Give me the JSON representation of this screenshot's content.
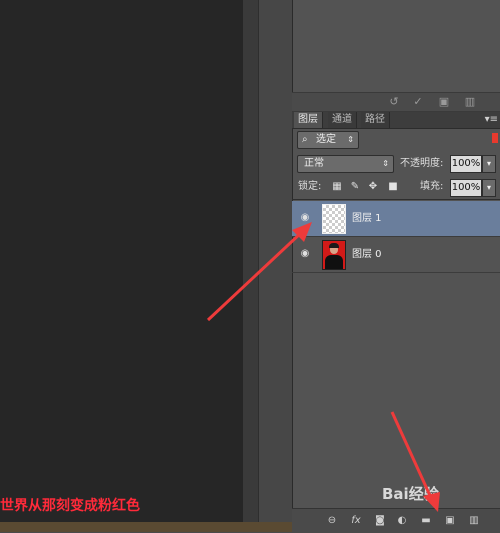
{
  "history_panel": {
    "icons": [
      "undo-icon",
      "check-icon",
      "new-snapshot-icon",
      "trash-icon"
    ]
  },
  "layers_panel": {
    "tabs": [
      {
        "label": "图层",
        "active": true
      },
      {
        "label": "通道",
        "active": false
      },
      {
        "label": "路径",
        "active": false
      }
    ],
    "filter": {
      "value": "选定"
    },
    "blend_mode": "正常",
    "opacity_label": "不透明度:",
    "opacity_value": "100%",
    "lock_label": "锁定:",
    "fill_label": "填充:",
    "fill_value": "100%",
    "layers": [
      {
        "name": "图层 1",
        "selected": true,
        "visible": true,
        "thumbnail": "transparent"
      },
      {
        "name": "图层 0",
        "selected": false,
        "visible": true,
        "thumbnail": "portrait-red-background"
      }
    ],
    "bottom_icons": [
      "link-icon",
      "fx-icon",
      "mask-icon",
      "adjustment-icon",
      "group-folder-icon",
      "new-layer-icon",
      "trash-icon"
    ]
  },
  "caption": "世界从那刻变成粉红色",
  "watermark": "Bai经验",
  "colors": {
    "annotation_arrow": "#ee3b3b",
    "selected_layer": "#6a7e9c",
    "caption_text": "#ff2a3a"
  }
}
